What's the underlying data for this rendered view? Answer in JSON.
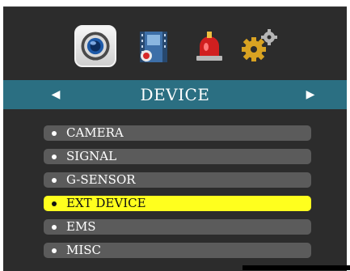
{
  "tabs": [
    {
      "name": "device-tab",
      "icon": "camera-lens-icon",
      "active": true
    },
    {
      "name": "recording-tab",
      "icon": "film-record-icon",
      "active": false
    },
    {
      "name": "event-tab",
      "icon": "alarm-siren-icon",
      "active": false
    },
    {
      "name": "settings-tab",
      "icon": "gears-icon",
      "active": false
    }
  ],
  "header": {
    "title": "DEVICE",
    "left_arrow": "◀",
    "right_arrow": "▶",
    "color": "#2b6f82"
  },
  "menu": {
    "items": [
      {
        "label": "CAMERA",
        "selected": false
      },
      {
        "label": "SIGNAL",
        "selected": false
      },
      {
        "label": "G-SENSOR",
        "selected": false
      },
      {
        "label": "EXT DEVICE",
        "selected": true
      },
      {
        "label": "EMS",
        "selected": false
      },
      {
        "label": "MISC",
        "selected": false
      }
    ],
    "highlight_color": "#ffff1e"
  }
}
